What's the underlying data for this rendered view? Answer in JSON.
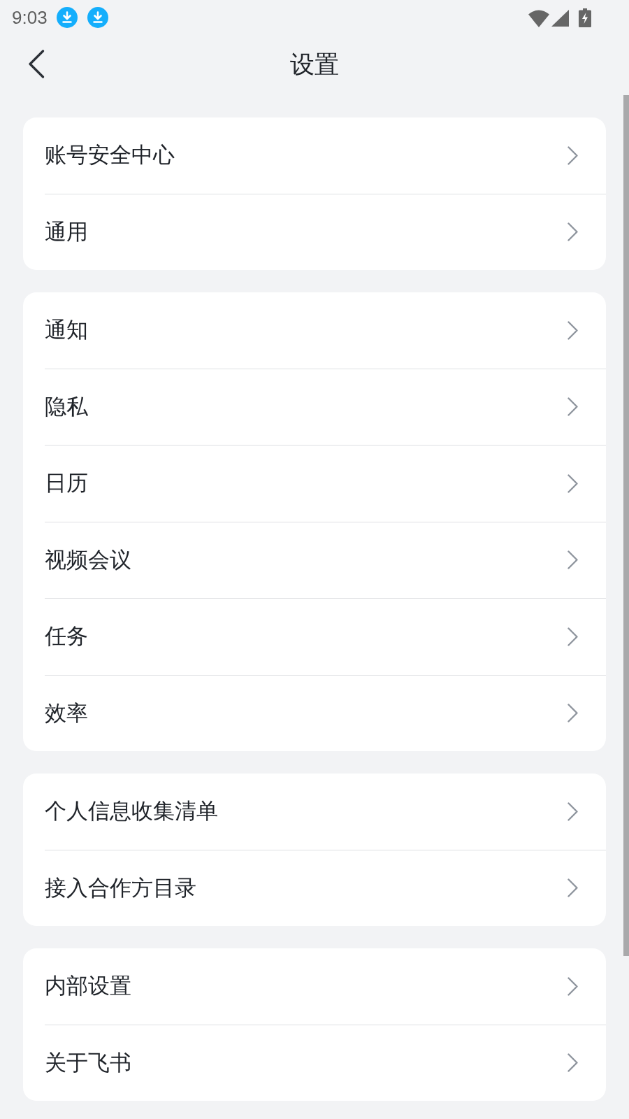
{
  "status_bar": {
    "time": "9:03"
  },
  "header": {
    "title": "设置"
  },
  "groups": [
    {
      "items": [
        {
          "label": "账号安全中心"
        },
        {
          "label": "通用"
        }
      ]
    },
    {
      "items": [
        {
          "label": "通知"
        },
        {
          "label": "隐私"
        },
        {
          "label": "日历"
        },
        {
          "label": "视频会议"
        },
        {
          "label": "任务"
        },
        {
          "label": "效率"
        }
      ]
    },
    {
      "items": [
        {
          "label": "个人信息收集清单"
        },
        {
          "label": "接入合作方目录"
        }
      ]
    },
    {
      "items": [
        {
          "label": "内部设置"
        },
        {
          "label": "关于飞书"
        }
      ]
    }
  ]
}
